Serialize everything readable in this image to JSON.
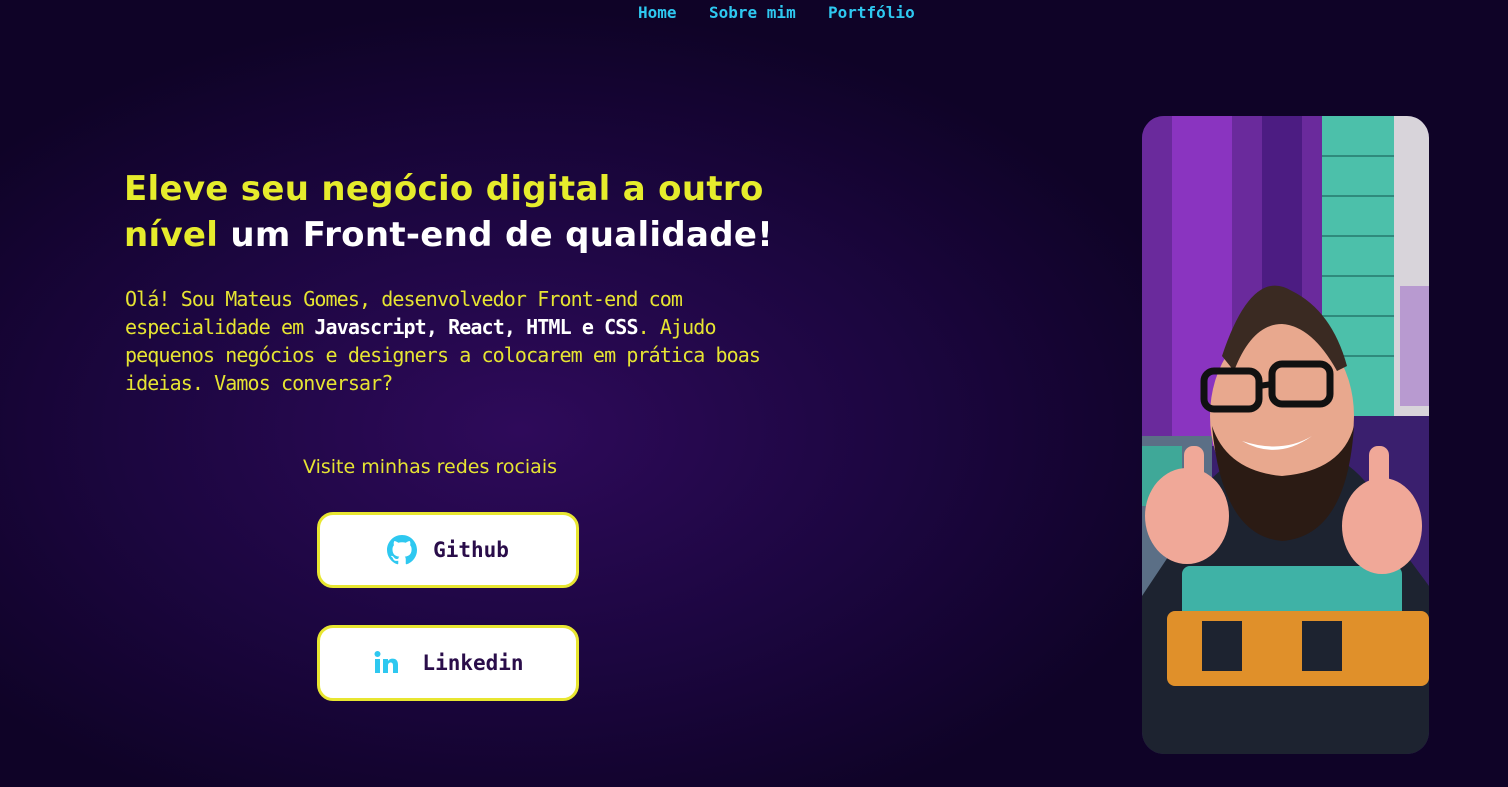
{
  "nav": {
    "items": [
      {
        "label": "Home"
      },
      {
        "label": "Sobre mim"
      },
      {
        "label": "Portfólio"
      }
    ]
  },
  "hero": {
    "headline_highlight": "Eleve seu negócio digital a outro nível",
    "headline_rest": " um Front-end de qualidade!",
    "intro": {
      "part1": "Olá! Sou Mateus Gomes, desenvolvedor Front-end com especialidade em ",
      "tech1": "Javascript",
      "sep1": ", ",
      "tech2": "React",
      "sep2": ", ",
      "tech3": "HTML",
      "sep3": " e ",
      "tech4": "CSS",
      "part2": ". Ajudo pequenos negócios e designers a colocarem em prática boas ideias. Vamos conversar?"
    }
  },
  "socials": {
    "title": "Visite minhas redes rociais",
    "buttons": [
      {
        "label": "Github",
        "icon": "github-icon"
      },
      {
        "label": "Linkedin",
        "icon": "linkedin-icon"
      }
    ]
  },
  "colors": {
    "accent_yellow": "#e6ec2c",
    "accent_cyan": "#2ec8f0",
    "background": "#1c0640",
    "button_text": "#2a0d4a"
  },
  "profile_photo": {
    "subject": "smiling bearded man with glasses giving two thumbs up"
  }
}
